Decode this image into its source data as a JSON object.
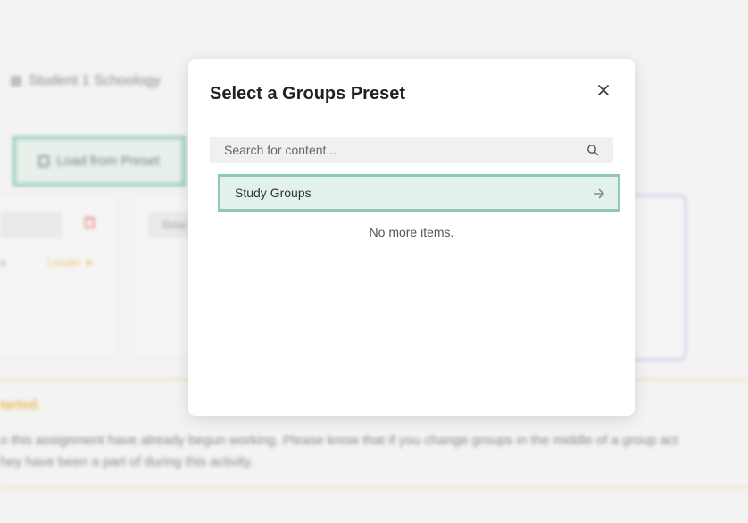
{
  "background": {
    "breadcrumb": {
      "course": "Student 1 Schoology"
    },
    "load_button_label": "Load from Preset",
    "group_chip_label": "Grou",
    "member_fragment": "s",
    "leader_label": "Leader",
    "notice": {
      "heading": "tarted.",
      "line1": "o this assignment have already begun working. Please know that if you change groups in the middle of a group act",
      "line2": "hey have been a part of during this activity."
    }
  },
  "modal": {
    "title": "Select a Groups Preset",
    "search": {
      "placeholder": "Search for content..."
    },
    "items": [
      {
        "label": "Study Groups"
      }
    ],
    "empty_text": "No more items."
  },
  "colors": {
    "accent": "#90c9b3",
    "item_bg": "#e3f1ec",
    "warning": "#e4ad2e",
    "danger": "#e07272"
  },
  "icons": {
    "close": "close-icon",
    "search": "search-icon",
    "item_arrow": "arrow-right-icon",
    "leader": "star-icon",
    "delete": "trash-icon",
    "breadcrumb": "list-icon",
    "load": "save-icon"
  }
}
